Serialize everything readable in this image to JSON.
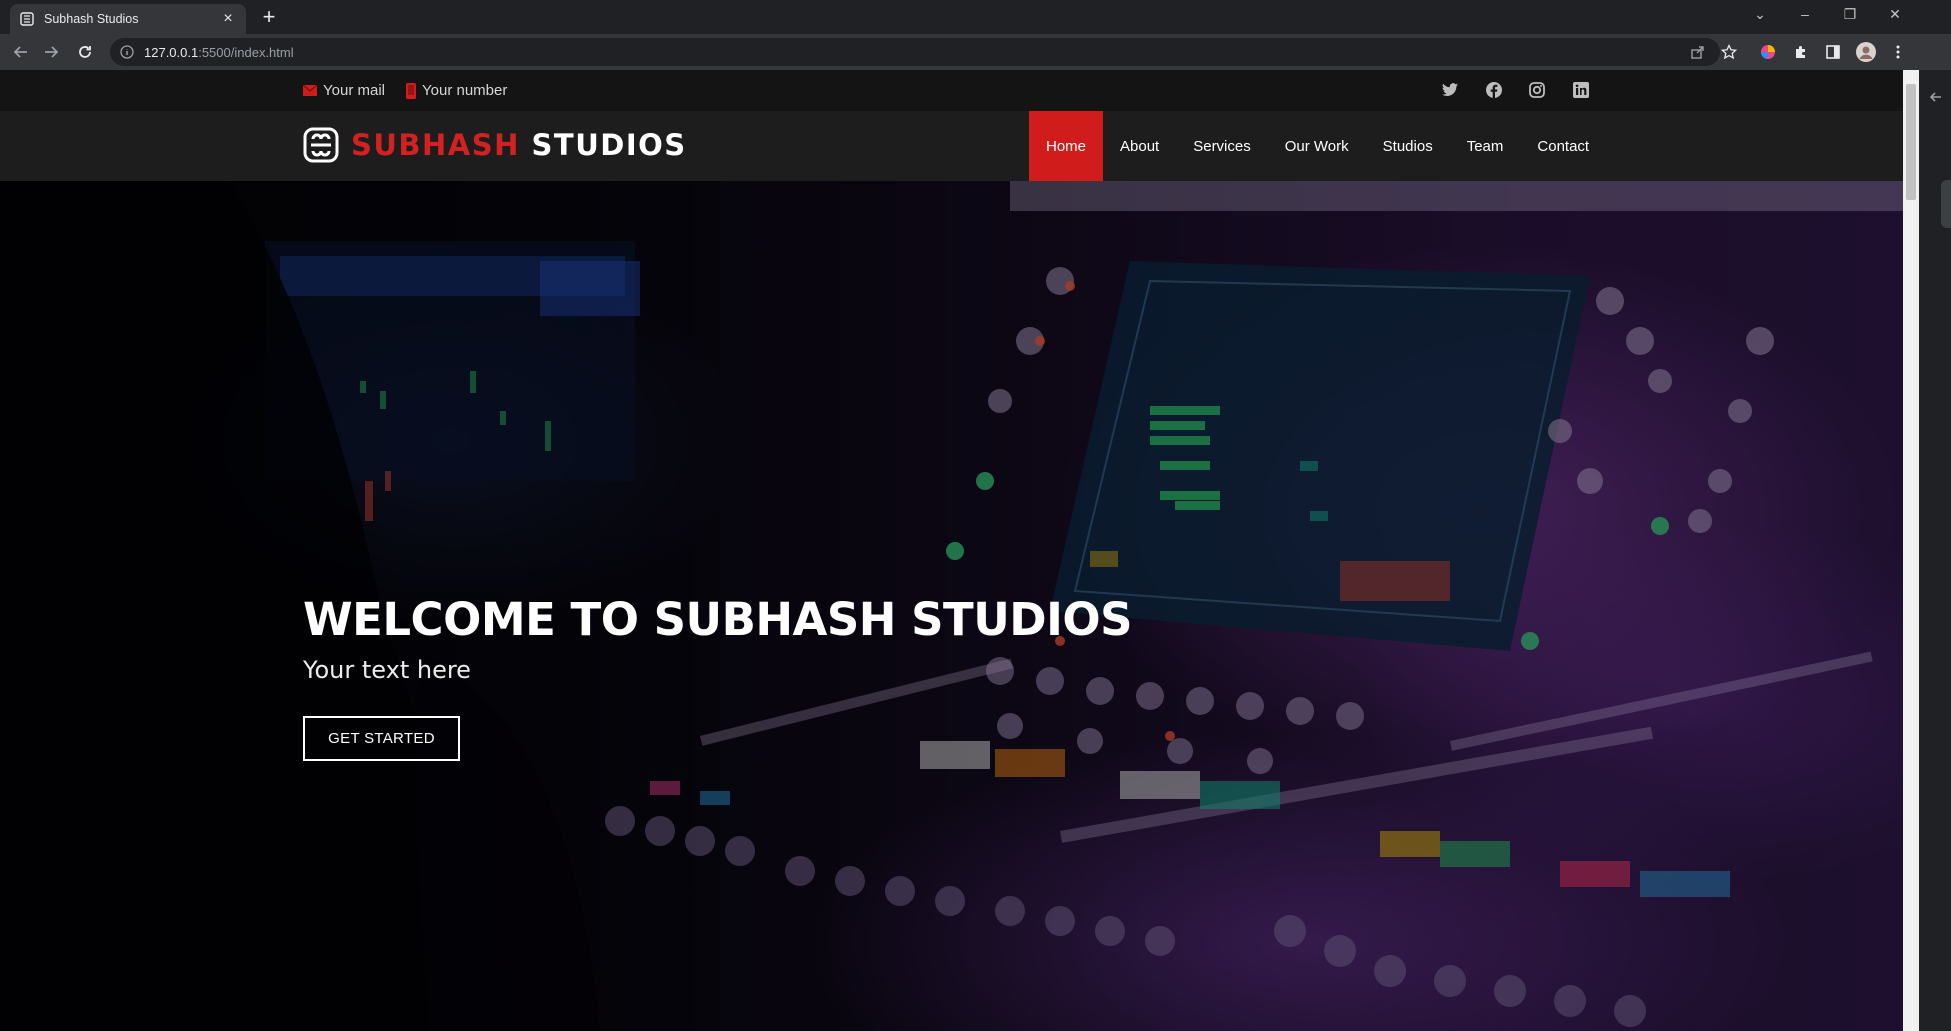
{
  "browser": {
    "tab_title": "Subhash Studios",
    "url_host": "127.0.0.1",
    "url_path": ":5500/index.html"
  },
  "topbar": {
    "mail_label": "Your mail",
    "number_label": "Your number",
    "social_icons": [
      "twitter-icon",
      "facebook-icon",
      "instagram-icon",
      "linkedin-icon"
    ]
  },
  "header": {
    "logo_accent": "SUBHASH",
    "logo_rest": "STUDIOS",
    "nav": [
      {
        "label": "Home",
        "active": true
      },
      {
        "label": "About",
        "active": false
      },
      {
        "label": "Services",
        "active": false
      },
      {
        "label": "Our Work",
        "active": false
      },
      {
        "label": "Studios",
        "active": false
      },
      {
        "label": "Team",
        "active": false
      },
      {
        "label": "Contact",
        "active": false
      }
    ]
  },
  "hero": {
    "title": "WELCOME TO SUBHASH STUDIOS",
    "subtitle": "Your text here",
    "cta_label": "GET STARTED"
  },
  "colors": {
    "accent": "#d11c1c",
    "topbar_bg": "#141414",
    "header_bg": "#1d1d1d",
    "hero_tint": "#2d1846"
  }
}
